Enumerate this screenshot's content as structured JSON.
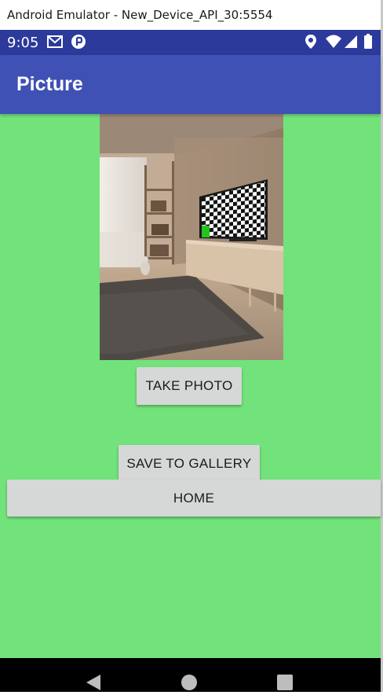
{
  "window": {
    "title": "Android Emulator - New_Device_API_30:5554"
  },
  "status_bar": {
    "time": "9:05",
    "left_icons": [
      "gmail-icon",
      "app-notification-icon"
    ],
    "right_icons": [
      "location-icon",
      "wifi-icon",
      "signal-icon",
      "battery-icon"
    ]
  },
  "app_bar": {
    "title": "Picture"
  },
  "content": {
    "background_color": "#72e37a",
    "image": "living-room-photo",
    "buttons": {
      "take_photo": "TAKE PHOTO",
      "save_to_gallery": "SAVE TO GALLERY",
      "home": "HOME"
    }
  },
  "nav_bar": {
    "icons": [
      "back-icon",
      "home-icon",
      "recents-icon"
    ]
  },
  "colors": {
    "primary": "#3f51b5",
    "primary_dark": "#2b3a9b",
    "button": "#d6d7d7"
  }
}
